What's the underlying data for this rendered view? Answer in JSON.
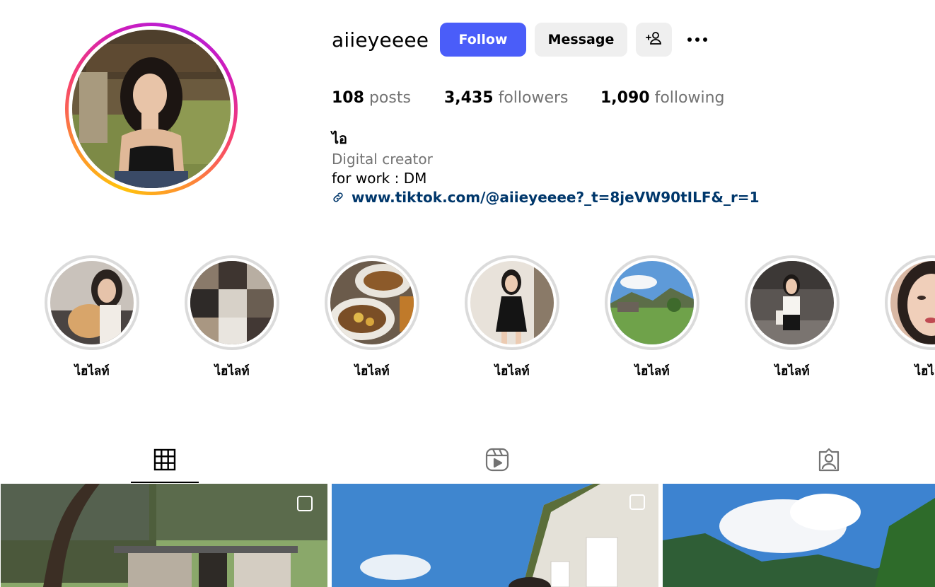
{
  "profile": {
    "username": "aiieyeeee",
    "follow_label": "Follow",
    "message_label": "Message",
    "stats": {
      "posts_count": "108",
      "posts_label": "posts",
      "followers_count": "3,435",
      "followers_label": "followers",
      "following_count": "1,090",
      "following_label": "following"
    },
    "bio": {
      "name": "ไอ",
      "category": "Digital creator",
      "text": "for work : DM",
      "link": "www.tiktok.com/@aiieyeeee?_t=8jeVW90tILF&_r=1"
    }
  },
  "highlights": [
    {
      "label": "ไฮไลท์"
    },
    {
      "label": "ไฮไลท์"
    },
    {
      "label": "ไฮไลท์"
    },
    {
      "label": "ไฮไลท์"
    },
    {
      "label": "ไฮไลท์"
    },
    {
      "label": "ไฮไลท์"
    },
    {
      "label": "ไฮไลท์"
    }
  ],
  "tabs": [
    {
      "icon": "grid-icon",
      "active": true
    },
    {
      "icon": "reels-icon",
      "active": false
    },
    {
      "icon": "tagged-icon",
      "active": false
    }
  ],
  "colors": {
    "follow_button": "#4a5df9",
    "secondary_button": "#efefef",
    "link": "#00376b",
    "muted_text": "#737373"
  }
}
